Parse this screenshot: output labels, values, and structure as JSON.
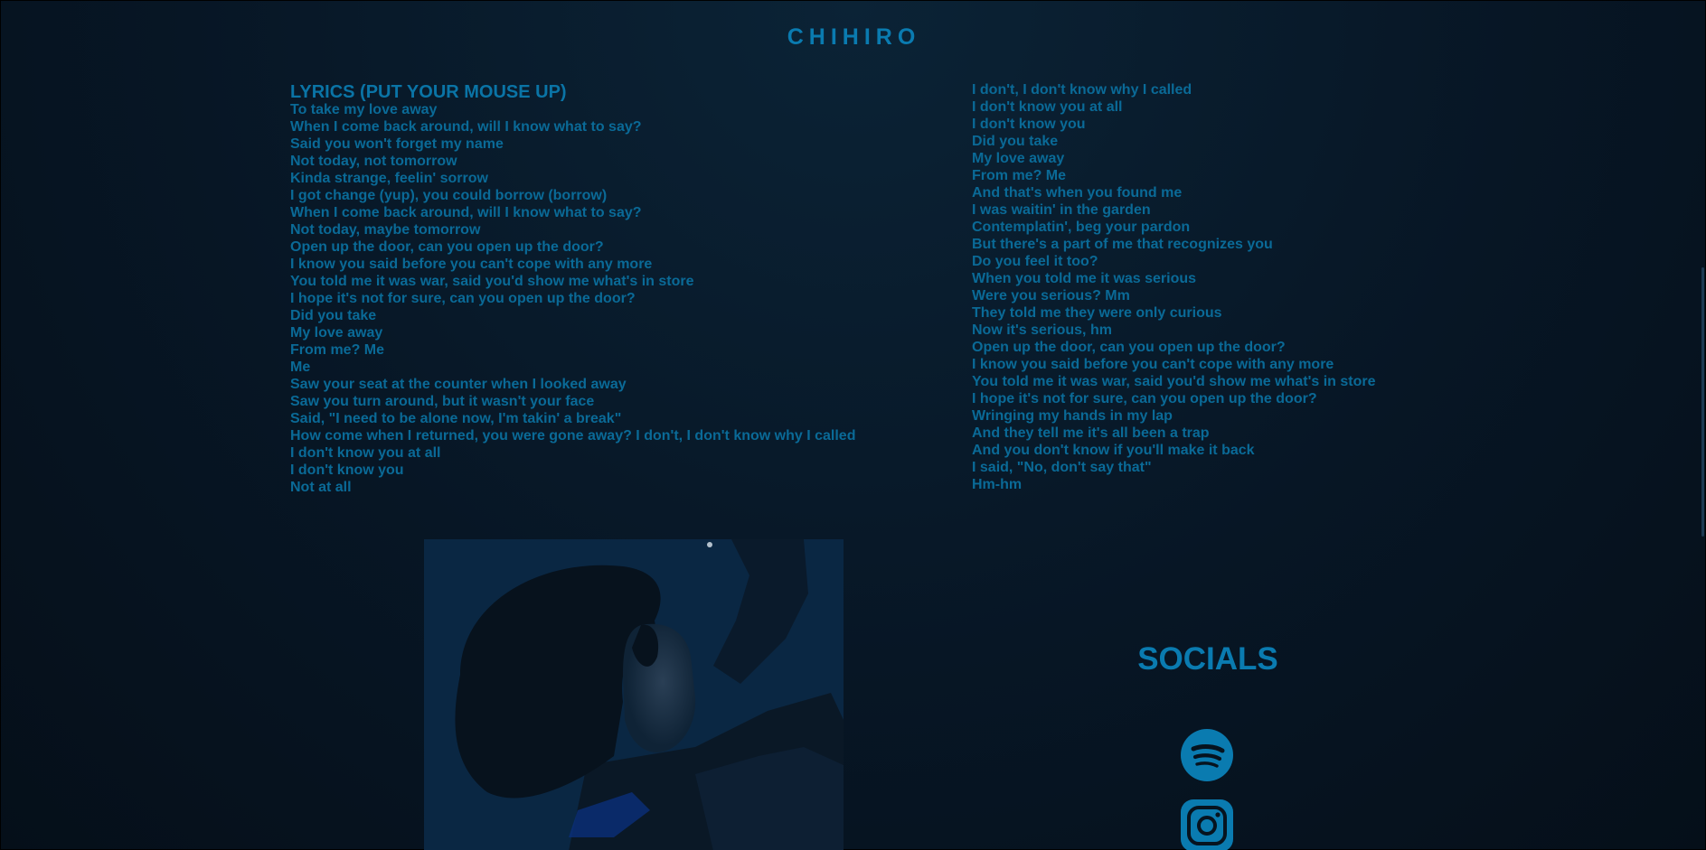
{
  "site": {
    "title": "CHIHIRO"
  },
  "lyrics": {
    "heading": "LYRICS (PUT YOUR MOUSE UP)",
    "left_lines": [
      "To take my love away",
      "When I come back around, will I know what to say?",
      "Said you won't forget my name",
      "Not today, not tomorrow",
      "Kinda strange, feelin' sorrow",
      "I got change (yup), you could borrow (borrow)",
      "When I come back around, will I know what to say?",
      "Not today, maybe tomorrow",
      "Open up the door, can you open up the door?",
      "I know you said before you can't cope with any more",
      "You told me it was war, said you'd show me what's in store",
      "I hope it's not for sure, can you open up the door?",
      "Did you take",
      "My love away",
      "From me? Me",
      "Me",
      "Saw your seat at the counter when I looked away",
      "Saw you turn around, but it wasn't your face",
      "Said, \"I need to be alone now, I'm takin' a break\"",
      "How come when I returned, you were gone away? I don't, I don't know why I called",
      "I don't know you at all",
      "I don't know you",
      "Not at all"
    ],
    "right_lines": [
      "I don't, I don't know why I called",
      "I don't know you at all",
      "I don't know you",
      "Did you take",
      "My love away",
      "From me? Me",
      "And that's when you found me",
      "I was waitin' in the garden",
      "Contemplatin', beg your pardon",
      "But there's a part of me that recognizes you",
      "Do you feel it too?",
      "When you told me it was serious",
      "Were you serious? Mm",
      "They told me they were only curious",
      "Now it's serious, hm",
      "Open up the door, can you open up the door?",
      "I know you said before you can't cope with any more",
      "You told me it was war, said you'd show me what's in store",
      "I hope it's not for sure, can you open up the door?",
      "Wringing my hands in my lap",
      "And they tell me it's all been a trap",
      "And you don't know if you'll make it back",
      "I said, \"No, don't say that\"",
      "Hm-hm"
    ]
  },
  "socials": {
    "title": "SOCIALS",
    "icons": [
      "spotify-icon",
      "instagram-icon"
    ]
  },
  "colors": {
    "background": "#06131f",
    "accent": "#0a7bb0",
    "text": "#0a6a97"
  }
}
